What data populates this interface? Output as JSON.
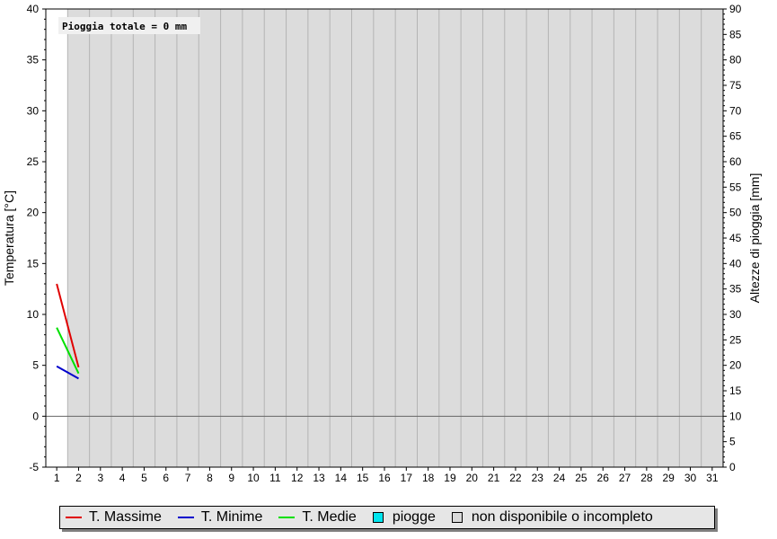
{
  "chart_data": {
    "type": "line",
    "title": "",
    "annotation": "Pioggia totale = 0 mm",
    "ylabel": "Temperatura [°C]",
    "y2label": "Altezze di pioggia [mm]",
    "ylim": [
      -5,
      40
    ],
    "y2lim": [
      0,
      90
    ],
    "yticks": [
      -5,
      0,
      5,
      10,
      15,
      20,
      25,
      30,
      35,
      40
    ],
    "y2ticks": [
      0,
      5,
      10,
      15,
      20,
      25,
      30,
      35,
      40,
      45,
      50,
      55,
      60,
      65,
      70,
      75,
      80,
      85,
      90
    ],
    "x": [
      1,
      2,
      3,
      4,
      5,
      6,
      7,
      8,
      9,
      10,
      11,
      12,
      13,
      14,
      15,
      16,
      17,
      18,
      19,
      20,
      21,
      22,
      23,
      24,
      25,
      26,
      27,
      28,
      29,
      30,
      31
    ],
    "unavailable_days": [
      2,
      3,
      4,
      5,
      6,
      7,
      8,
      9,
      10,
      11,
      12,
      13,
      14,
      15,
      16,
      17,
      18,
      19,
      20,
      21,
      22,
      23,
      24,
      25,
      26,
      27,
      28,
      29,
      30,
      31
    ],
    "series": [
      {
        "name": "T. Massime",
        "color": "#e00000",
        "x": [
          1,
          2
        ],
        "values": [
          13.0,
          4.8
        ]
      },
      {
        "name": "T. Minime",
        "color": "#0000cc",
        "x": [
          1,
          2
        ],
        "values": [
          4.9,
          3.7
        ]
      },
      {
        "name": "T. Medie",
        "color": "#00e000",
        "x": [
          1,
          2
        ],
        "values": [
          8.7,
          4.2
        ]
      }
    ],
    "rain": [],
    "legend": [
      {
        "label": "T. Massime",
        "kind": "line",
        "color": "#e00000"
      },
      {
        "label": "T. Minime",
        "kind": "line",
        "color": "#0000cc"
      },
      {
        "label": "T. Medie",
        "kind": "line",
        "color": "#00e000"
      },
      {
        "label": "piogge",
        "kind": "box",
        "color": "#00e5ee"
      },
      {
        "label": "non disponibile o incompleto",
        "kind": "box",
        "color": "#d9d9d9"
      }
    ],
    "legend_position": "bottom",
    "colors": {
      "unavailable": "#dcdcdc",
      "grid": "#b4b4b4",
      "zero_line": "#666666",
      "rain": "#00e5ee"
    }
  }
}
